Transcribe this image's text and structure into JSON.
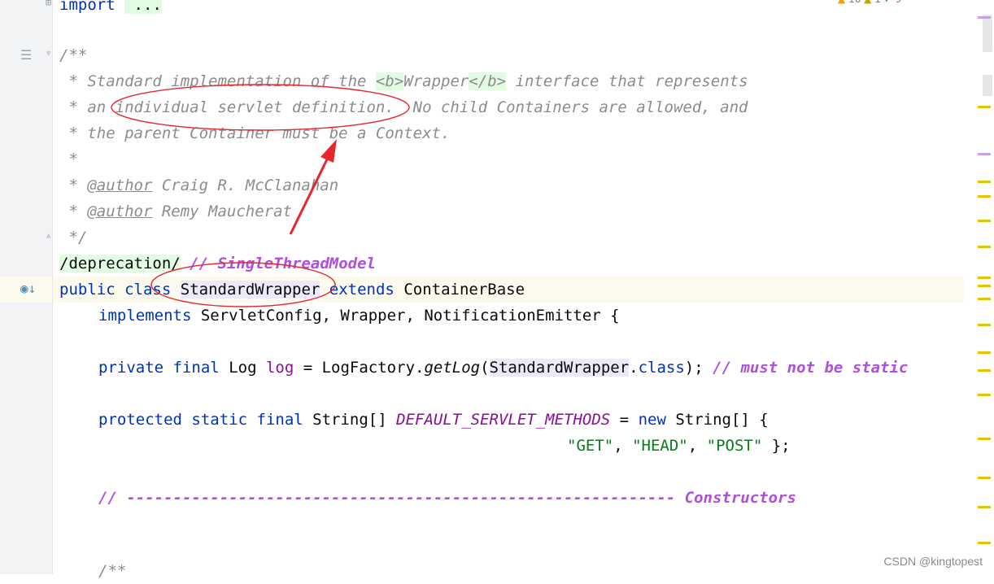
{
  "code": {
    "l0": {
      "kw": "import",
      "fold": " ..."
    },
    "l2": "/**",
    "l3": {
      "a": " * Standard implementation of the ",
      "b1": "<b>",
      "w": "Wrapper",
      "b2": "</b>",
      "c": " interface that represents"
    },
    "l4": " * an individual servlet definition.  No child Containers are allowed, and",
    "l5": " * the parent Container must be a Context.",
    "l6": " *",
    "l7": {
      "star": " * ",
      "tag": "@author",
      "name": " Craig R. McClanahan"
    },
    "l8": {
      "star": " * ",
      "tag": "@author",
      "name": " Remy Maucherat"
    },
    "l9": " */",
    "l10": {
      "fold": "/deprecation/",
      "sp": " ",
      "slash": "// ",
      "todo": "SingleThreadModel"
    },
    "l11": {
      "public": "public",
      "class": "class",
      "name": "StandardWrapper",
      "extends": "extends",
      "base": "ContainerBase"
    },
    "l12": {
      "implements": "implements",
      "rest": " ServletConfig, Wrapper, NotificationEmitter {"
    },
    "l14": {
      "private": "private",
      "final": "final",
      "type": "Log",
      "var": "log",
      "eq": " = LogFactory.",
      "method": "getLog",
      "open": "(",
      "arg": "StandardWrapper",
      "dot": ".",
      "cls": "class",
      "close": ");",
      "comment": "// must not be static"
    },
    "l16": {
      "protected": "protected",
      "static": "static",
      "final": "final",
      "type": "String[]",
      "const": "DEFAULT_SERVLET_METHODS",
      "eq": " = ",
      "new": "new",
      "rest": " String[] {"
    },
    "l17": {
      "s1": "\"GET\"",
      "c1": ", ",
      "s2": "\"HEAD\"",
      "c2": ", ",
      "s3": "\"POST\"",
      "end": " };"
    },
    "l19": {
      "slash": "// ",
      "dashes": "----------------------------------------------------------- ",
      "todo": "Constructors"
    },
    "l22": "/**"
  },
  "inspections": {
    "warnings": "16",
    "weak_warnings": "1",
    "typos": "9"
  },
  "watermark": "CSDN @kingtopest",
  "colors": {
    "keyword": "#0033b3",
    "comment": "#8c8c8c",
    "todo": "#b04fdb",
    "string": "#067d17",
    "annotation": "#e8262b"
  }
}
